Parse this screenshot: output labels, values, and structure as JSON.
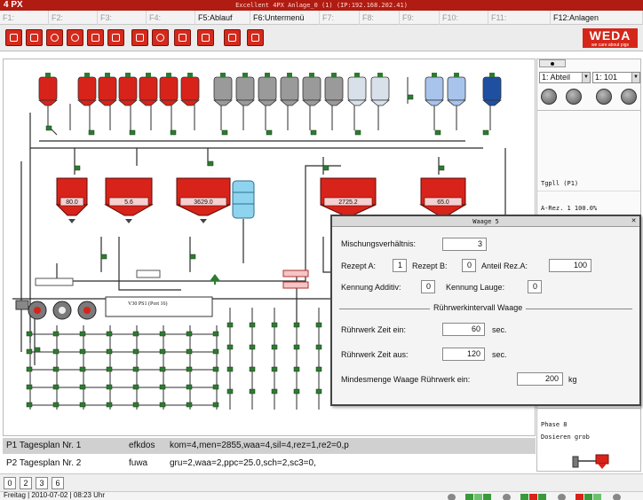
{
  "titlebar": {
    "logo": "4 PX",
    "title": "Excellent 4PX Anlage_0 (1) (IP:192.168.202.41)"
  },
  "fkeys": [
    {
      "label": "F1:",
      "enabled": false
    },
    {
      "label": "F2:",
      "enabled": false
    },
    {
      "label": "F3:",
      "enabled": false
    },
    {
      "label": "F4:",
      "enabled": false
    },
    {
      "label": "F5:Ablauf",
      "enabled": true
    },
    {
      "label": "F6:Untermenü",
      "enabled": true
    },
    {
      "label": "F7:",
      "enabled": false
    },
    {
      "label": "F8:",
      "enabled": false
    },
    {
      "label": "F9:",
      "enabled": false
    },
    {
      "label": "F10:",
      "enabled": false
    },
    {
      "label": "F11:",
      "enabled": false
    },
    {
      "label": "F12:Anlagen",
      "enabled": true
    }
  ],
  "brand": {
    "name": "WEDA",
    "slogan": "we care about pigs",
    "color": "#d4271a"
  },
  "colors": {
    "silo_red": "#d8231a",
    "silo_grey": "#9a9a9a",
    "silo_lightblue": "#a8c4ec",
    "silo_blue": "#1f4fa0",
    "pipe": "#2b2b2b",
    "valve_green": "#2f7a32",
    "cyan_tank": "#8fd4ef"
  },
  "tanks": [
    {
      "value": "80.0"
    },
    {
      "value": "5.6"
    },
    {
      "value": "3629.0"
    },
    {
      "value": "2725.2"
    },
    {
      "value": "65.0"
    }
  ],
  "process": {
    "module_label": "V30 PS1 (Port 16)"
  },
  "right_panel": {
    "select_1": "1: Abteil",
    "select_2": "1: 101",
    "feed_label": "Tgpll (P1)",
    "recipe_line": "A-Rez. 1 100.0%",
    "phase": "Phase 8",
    "phase_action": "Dosieren grob"
  },
  "dialog": {
    "title": "Waage 5",
    "mixing_ratio_label": "Mischungsverhältnis:",
    "mixing_ratio": "3",
    "recipe_a_label": "Rezept A:",
    "recipe_a": "1",
    "recipe_b_label": "Rezept B:",
    "recipe_b": "0",
    "share_a_label": "Anteil Rez.A:",
    "share_a": "100",
    "additive_label": "Kennung Additiv:",
    "additive": "0",
    "lye_label": "Kennung Lauge:",
    "lye": "0",
    "section_title": "Rührwerkintervall Waage",
    "stir_on_label": "Rührwerk Zeit ein:",
    "stir_on": "60",
    "stir_off_label": "Rührwerk Zeit aus:",
    "stir_off": "120",
    "sec_unit": "sec.",
    "min_amount_label": "Mindesmenge Waage Rührwerk ein:",
    "min_amount": "200",
    "kg_unit": "kg"
  },
  "plans": [
    {
      "name": "P1 Tagesplan Nr. 1",
      "code": "efkdos",
      "params": "kom=4,men=2855,waa=4,sil=4,rez=1,re2=0,p"
    },
    {
      "name": "P2 Tagesplan Nr. 2",
      "code": "fuwa",
      "params": "gru=2,waa=2,ppc=25.0,sch=2,sc3=0,"
    }
  ],
  "pages": [
    "0",
    "2",
    "3",
    "6"
  ],
  "status": {
    "datetime": "Freitag | 2010-07-02 | 08:23 Uhr"
  }
}
